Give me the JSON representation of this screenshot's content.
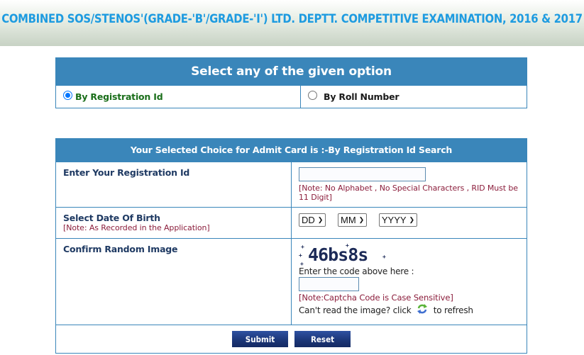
{
  "header": {
    "title": "COMBINED SOS/STENOS'(GRADE-'B'/GRADE-'I') LTD. DEPTT. COMPETITIVE EXAMINATION, 2016 & 2017"
  },
  "option_box": {
    "heading": "Select any of the given option",
    "options": [
      {
        "label": "By Registration Id",
        "selected": true
      },
      {
        "label": "By Roll Number",
        "selected": false
      }
    ]
  },
  "form": {
    "heading": "Your Selected Choice for Admit Card is :-By Registration Id Search",
    "registration": {
      "label": "Enter Your Registration Id",
      "value": "",
      "note": "[Note: No Alphabet , No Special Characters , RID Must be 11 Digit]"
    },
    "dob": {
      "label": "Select Date Of Birth",
      "note": "[Note: As Recorded in the Application]",
      "day": "DD",
      "month": "MM",
      "year": "YYYY"
    },
    "captcha": {
      "label": "Confirm Random Image",
      "code": "46bs8s",
      "prompt": "Enter the code above here :",
      "value": "",
      "note": "[Note:Captcha Code is Case Sensitive]",
      "refresh_prefix": "Can't read the image? click",
      "refresh_suffix": "to refresh",
      "refresh_icon": "refresh-icon"
    },
    "buttons": {
      "submit": "Submit",
      "reset": "Reset"
    }
  },
  "colors": {
    "title": "#1e9be0",
    "header_bar": "#3a86ba",
    "note": "#8b1d3b",
    "label": "#1f3a63",
    "selected_option": "#1a6e1a",
    "button": "#1b3576"
  }
}
